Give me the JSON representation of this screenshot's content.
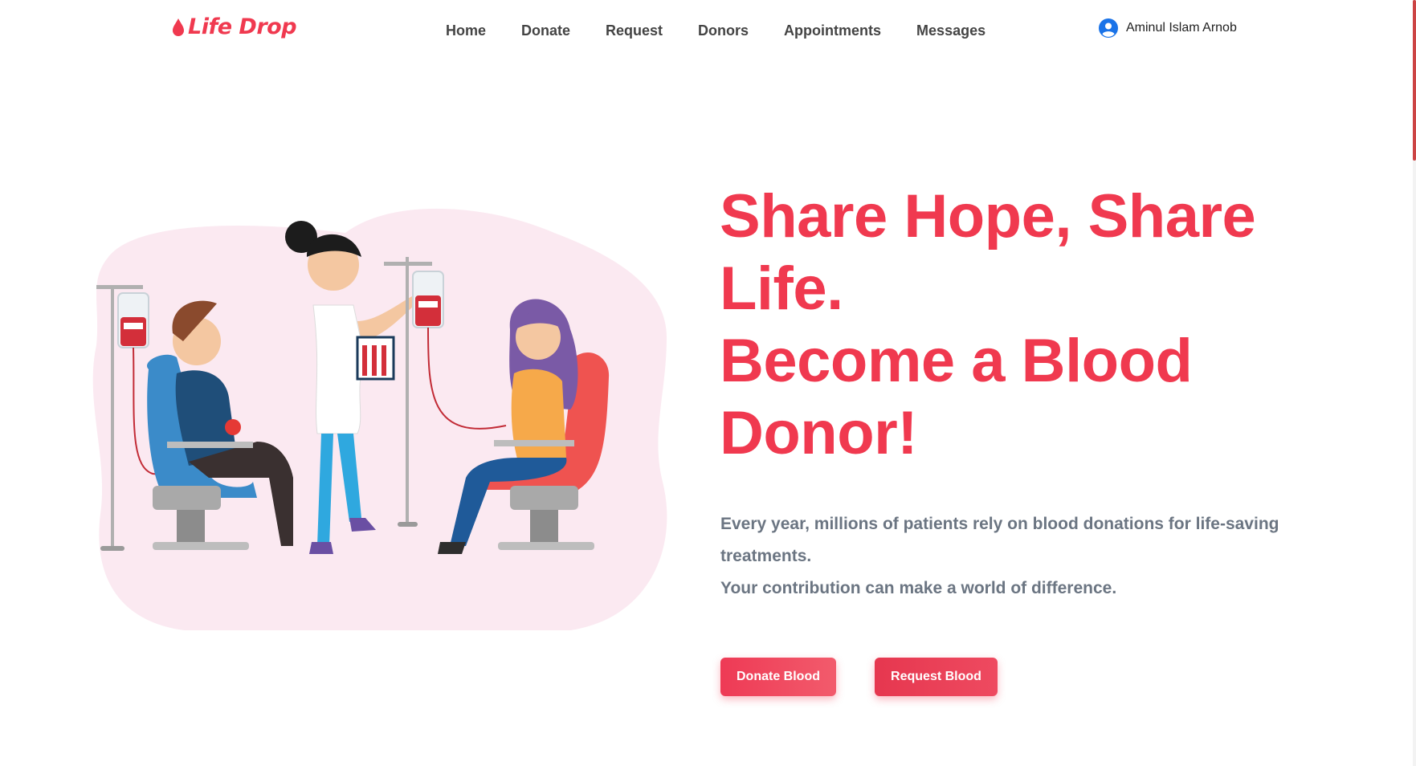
{
  "brand": {
    "name": "Life Drop",
    "icon": "blood-drop-icon",
    "color": "#f0394f"
  },
  "nav": {
    "items": [
      {
        "label": "Home"
      },
      {
        "label": "Donate"
      },
      {
        "label": "Request"
      },
      {
        "label": "Donors"
      },
      {
        "label": "Appointments"
      },
      {
        "label": "Messages"
      }
    ]
  },
  "user": {
    "name": "Aminul Islam Arnob",
    "icon": "user-avatar-icon"
  },
  "hero": {
    "title_line1": "Share Hope, Share",
    "title_line2": "Life.",
    "title_line3": "Become a Blood",
    "title_line4": "Donor!",
    "text_line1": "Every year, millions of patients rely on blood donations for life-saving",
    "text_line2": "treatments.",
    "text_line3": "Your contribution can make a world of difference.",
    "donate_label": "Donate Blood",
    "request_label": "Request Blood"
  },
  "colors": {
    "accent": "#f0394f",
    "body_text": "#6b7582",
    "blob": "#fbe9f1"
  }
}
